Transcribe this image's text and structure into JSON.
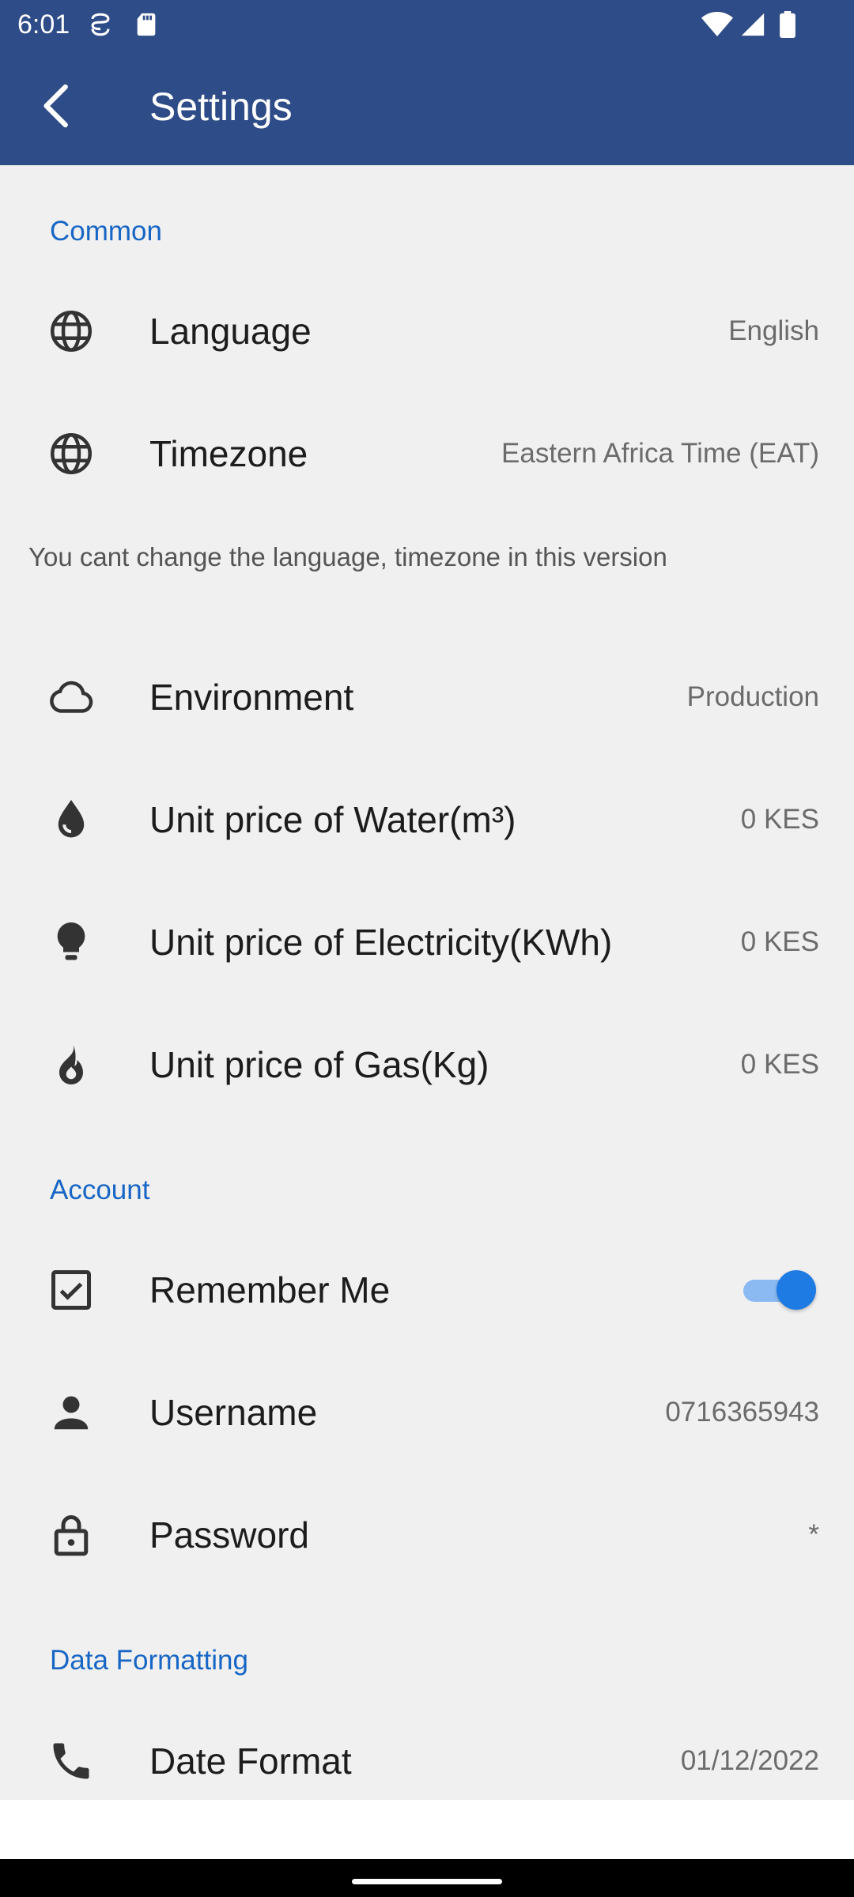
{
  "status_bar": {
    "time": "6:01",
    "icons": [
      "screenshot-icon",
      "sd-card-icon",
      "wifi-icon",
      "signal-icon",
      "battery-icon"
    ]
  },
  "app_bar": {
    "title": "Settings",
    "back_icon": "arrow-back-icon"
  },
  "colors": {
    "app_bar_bg": "#2e4c87",
    "accent": "#1766c5",
    "toggle_on": "#1e7be4",
    "content_bg": "#f0f0f0"
  },
  "sections": {
    "common": {
      "header": "Common",
      "language": {
        "label": "Language",
        "value": "English",
        "icon": "globe-icon"
      },
      "timezone": {
        "label": "Timezone",
        "value": "Eastern Africa Time (EAT)",
        "icon": "globe-icon"
      },
      "note": "You cant change the language, timezone in this version",
      "environment": {
        "label": "Environment",
        "value": "Production",
        "icon": "cloud-icon"
      },
      "water": {
        "label": "Unit price of Water(m³)",
        "value": "0 KES",
        "icon": "water-drop-icon"
      },
      "electricity": {
        "label": "Unit price of Electricity(KWh)",
        "value": "0 KES",
        "icon": "lightbulb-icon"
      },
      "gas": {
        "label": "Unit price of Gas(Kg)",
        "value": "0 KES",
        "icon": "flame-icon"
      }
    },
    "account": {
      "header": "Account",
      "remember_me": {
        "label": "Remember Me",
        "enabled": true,
        "icon": "checkbox-checked-icon"
      },
      "username": {
        "label": "Username",
        "value": "0716365943",
        "icon": "person-icon"
      },
      "password": {
        "label": "Password",
        "value": "*",
        "icon": "lock-icon"
      }
    },
    "data_formatting": {
      "header": "Data Formatting",
      "date_format": {
        "label": "Date Format",
        "value": "01/12/2022",
        "icon": "phone-icon"
      }
    }
  }
}
